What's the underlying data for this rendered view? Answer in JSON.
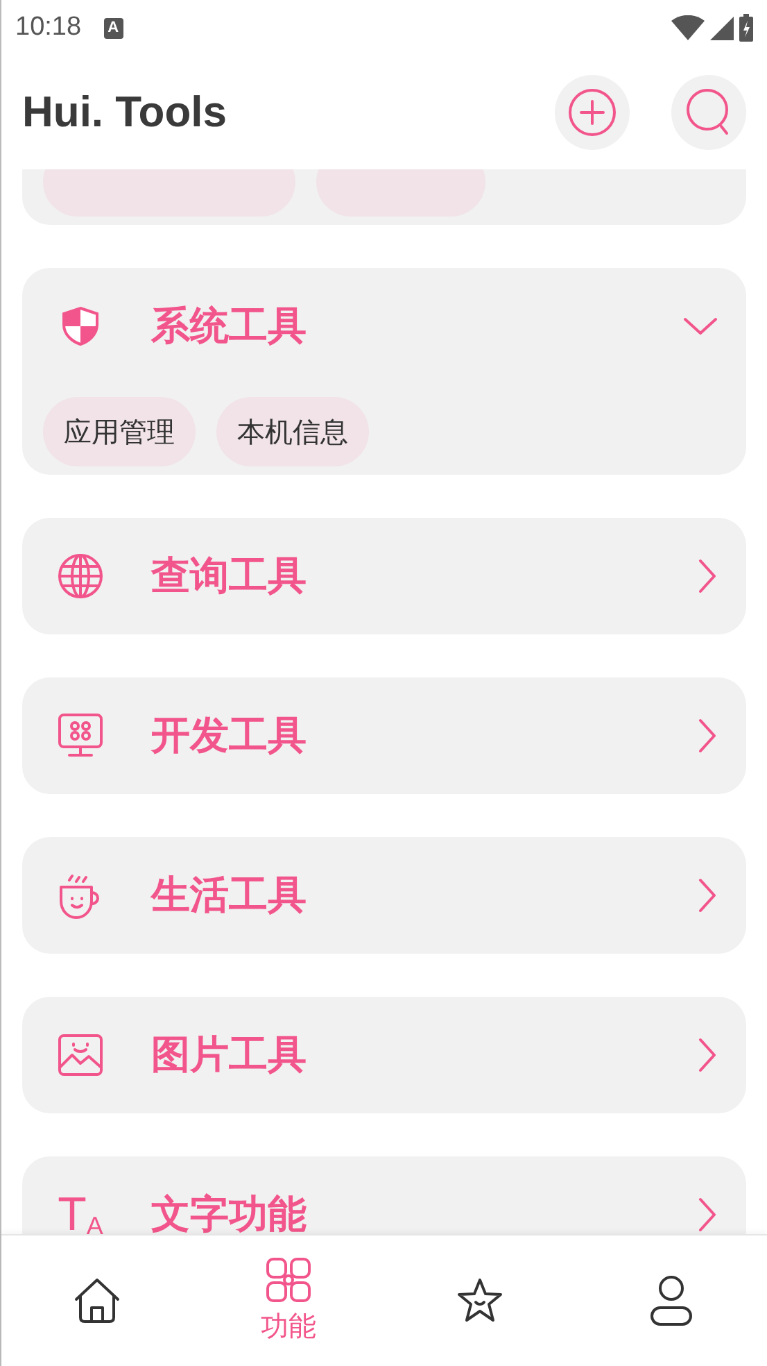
{
  "status_bar": {
    "time": "10:18",
    "notification_glyph": "A"
  },
  "app_bar": {
    "title": "Hui. Tools"
  },
  "categories": [
    {
      "title": "系统工具",
      "expanded": true,
      "chips": [
        "应用管理",
        "本机信息"
      ]
    },
    {
      "title": "查询工具",
      "expanded": false
    },
    {
      "title": "开发工具",
      "expanded": false
    },
    {
      "title": "生活工具",
      "expanded": false
    },
    {
      "title": "图片工具",
      "expanded": false
    },
    {
      "title": "文字功能",
      "expanded": false,
      "icon_glyphs": [
        "T",
        "A"
      ]
    }
  ],
  "bottom_nav": [
    {
      "selected": false
    },
    {
      "label": "功能",
      "selected": true
    },
    {
      "selected": false
    },
    {
      "selected": false
    }
  ]
}
